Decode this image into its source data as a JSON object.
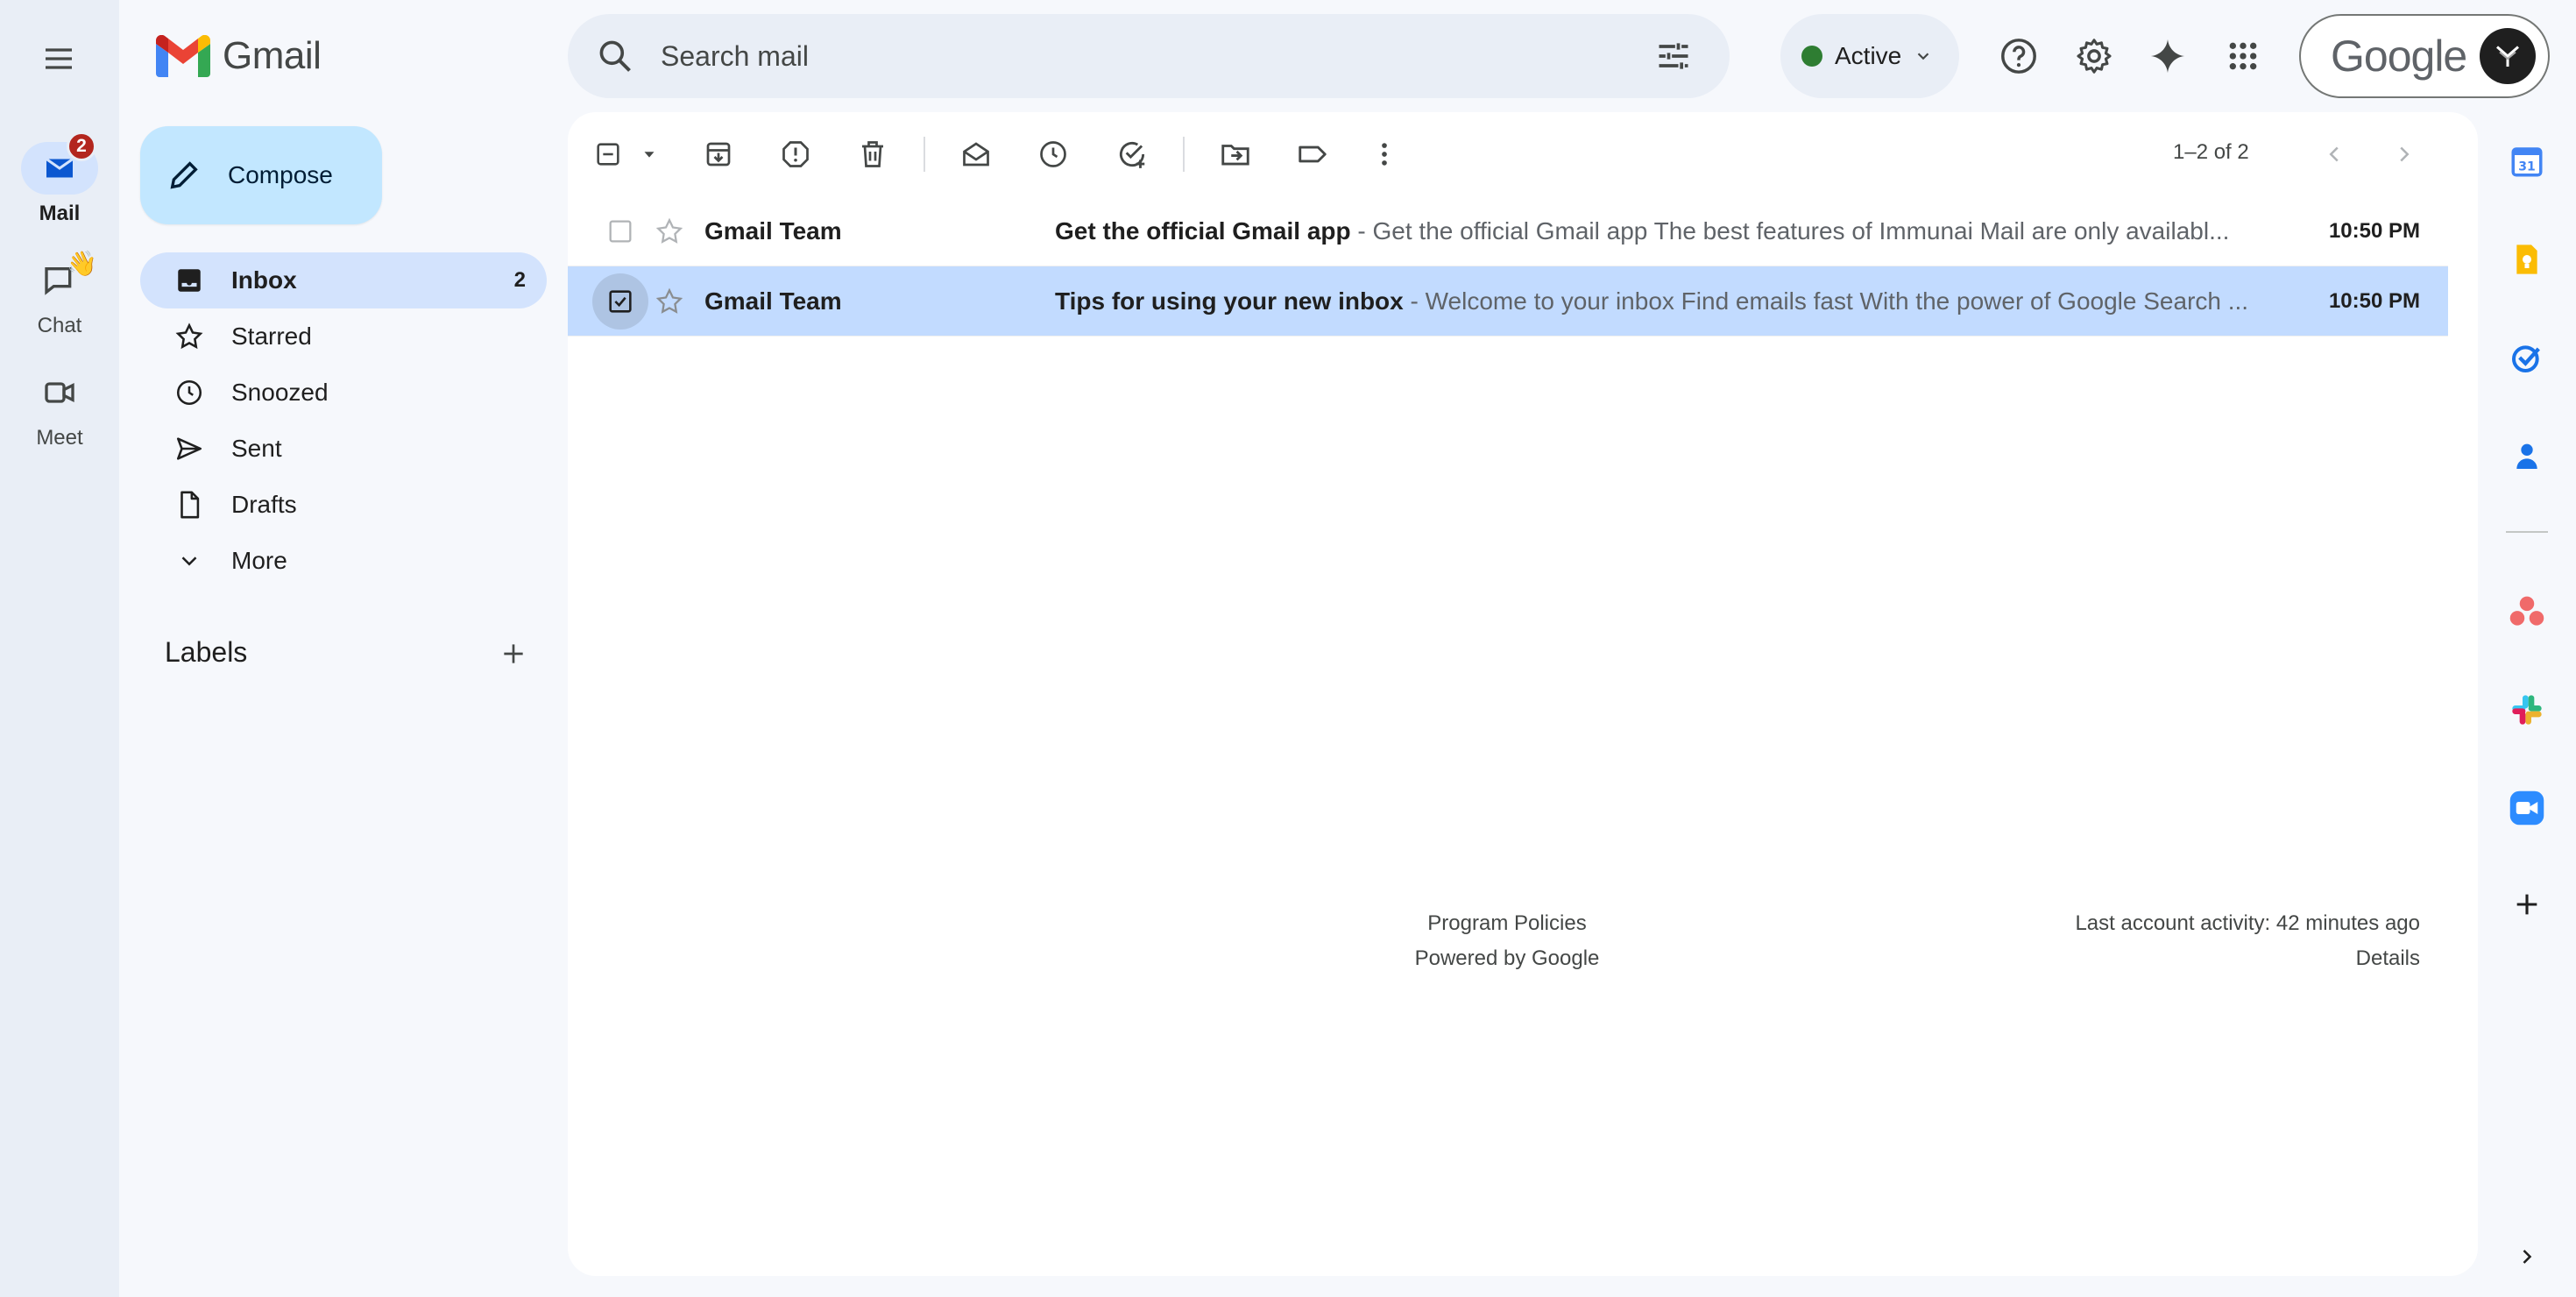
{
  "app": {
    "name": "Gmail",
    "colors": {
      "accent": "#0b57d0",
      "selection": "#c2dbff",
      "active_nav": "#d3e3fd",
      "compose": "#c2e7ff",
      "badge": "#b3261e",
      "status_green": "#2e7d32"
    }
  },
  "rail": {
    "items": [
      {
        "label": "Mail",
        "icon": "mail-icon",
        "badge": "2",
        "active": true
      },
      {
        "label": "Chat",
        "icon": "chat-icon",
        "active": false
      },
      {
        "label": "Meet",
        "icon": "video-icon",
        "active": false
      }
    ]
  },
  "compose": {
    "label": "Compose"
  },
  "nav": {
    "items": [
      {
        "label": "Inbox",
        "icon": "inbox-icon",
        "count": "2",
        "active": true
      },
      {
        "label": "Starred",
        "icon": "star-icon",
        "count": ""
      },
      {
        "label": "Snoozed",
        "icon": "clock-icon",
        "count": ""
      },
      {
        "label": "Sent",
        "icon": "send-icon",
        "count": ""
      },
      {
        "label": "Drafts",
        "icon": "draft-icon",
        "count": ""
      },
      {
        "label": "More",
        "icon": "chevron-down-icon",
        "count": ""
      }
    ]
  },
  "labels": {
    "title": "Labels"
  },
  "search": {
    "placeholder": "Search mail"
  },
  "status": {
    "label": "Active"
  },
  "account": {
    "brand": "Google"
  },
  "toolbar": {
    "pager": "1–2 of 2"
  },
  "emails": [
    {
      "sender": "Gmail Team",
      "subject": "Get the official Gmail app",
      "snippet": " - Get the official Gmail app The best features of Immunai Mail are only availabl...",
      "time": "10:50 PM",
      "selected": false
    },
    {
      "sender": "Gmail Team",
      "subject": "Tips for using your new inbox",
      "snippet": " - Welcome to your inbox Find emails fast With the power of Google Search ...",
      "time": "10:50 PM",
      "selected": true
    }
  ],
  "footer": {
    "program_policies": "Program Policies",
    "powered_by": "Powered by Google",
    "last_activity": "Last account activity: 42 minutes ago",
    "details": "Details"
  }
}
